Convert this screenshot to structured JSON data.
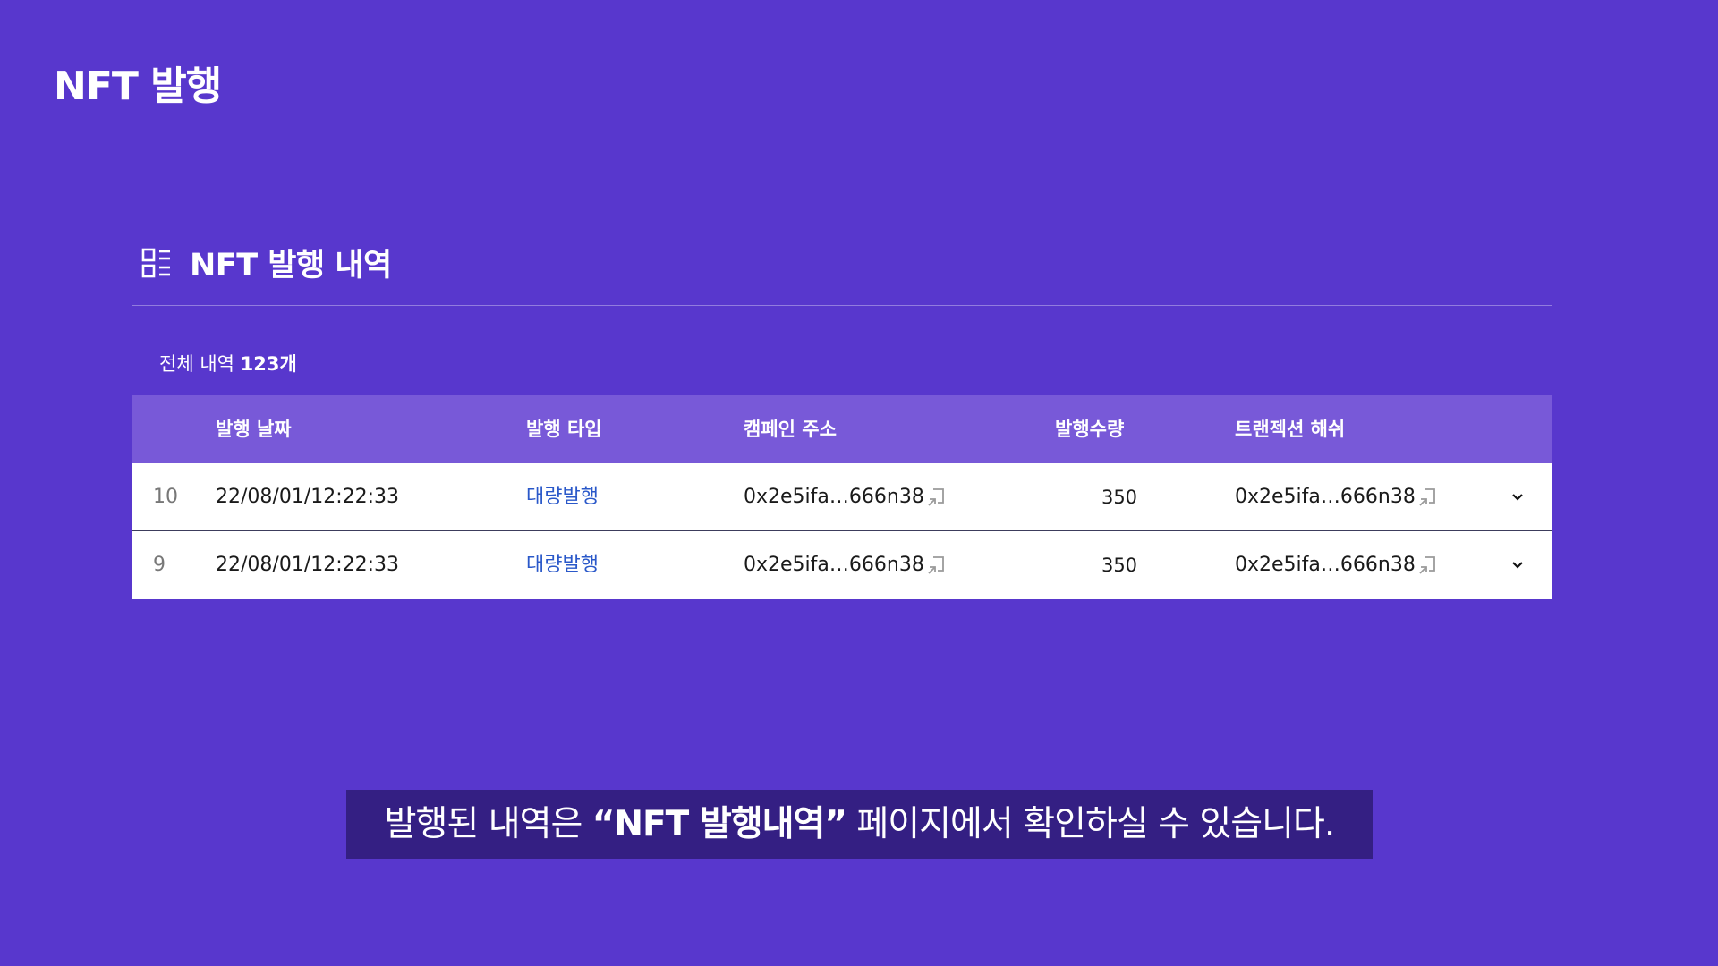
{
  "app": {
    "title": "NFT 발행"
  },
  "section": {
    "title": "NFT 발행 내역",
    "icon": "list-icon"
  },
  "summary": {
    "label": "전체 내역",
    "count": "123개"
  },
  "table": {
    "headers": {
      "date": "발행 날짜",
      "type": "발행 타입",
      "campaign": "캠페인 주소",
      "quantity": "발행수량",
      "hash": "트랜젝션 해쉬"
    },
    "rows": [
      {
        "index": "10",
        "date": "22/08/01/12:22:33",
        "type": "대량발행",
        "campaign": "0x2e5ifa…666n38",
        "quantity": "350",
        "hash": "0x2e5ifa…666n38"
      },
      {
        "index": "9",
        "date": "22/08/01/12:22:33",
        "type": "대량발행",
        "campaign": "0x2e5ifa…666n38",
        "quantity": "350",
        "hash": "0x2e5ifa…666n38"
      }
    ]
  },
  "caption": {
    "prefix": "발행된 내역은 ",
    "highlight": "“NFT 발행내역”",
    "suffix": " 페이지에서 확인하실 수 있습니다."
  },
  "colors": {
    "background": "#5837cd",
    "table_header": "#7859d8",
    "type_link": "#2a58c9",
    "caption_bg": "#341f83"
  }
}
